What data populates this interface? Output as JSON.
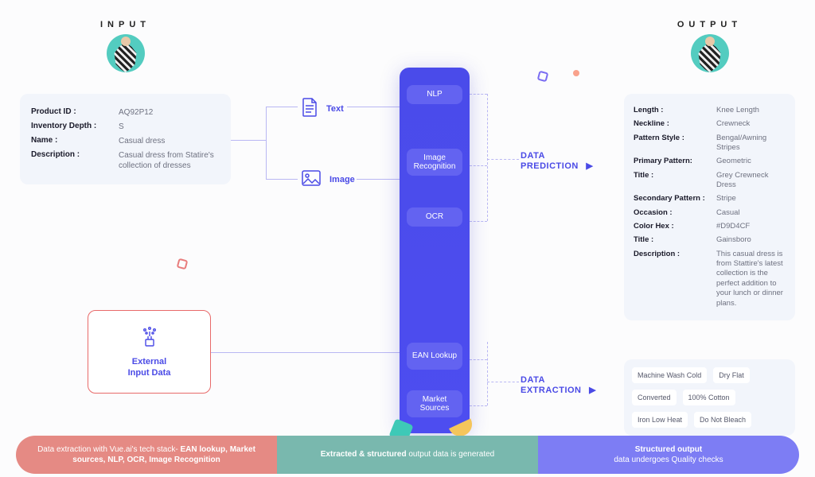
{
  "headers": {
    "input": "INPUT",
    "output": "OUTPUT"
  },
  "input_card": {
    "product_id_k": "Product ID :",
    "product_id_v": "AQ92P12",
    "inv_k": "Inventory Depth :",
    "inv_v": "S",
    "name_k": "Name :",
    "name_v": "Casual dress",
    "desc_k": "Description :",
    "desc_v": "Casual dress from Statire's collection of dresses"
  },
  "mid": {
    "text": "Text",
    "image": "Image"
  },
  "center_pills": {
    "nlp": "NLP",
    "imgrec": "Image Recognition",
    "ocr": "OCR",
    "ean": "EAN Lookup",
    "market": "Market Sources"
  },
  "external": {
    "label": "External\nInput Data"
  },
  "flow": {
    "prediction": "DATA\nPREDICTION",
    "extraction": "DATA\nEXTRACTION"
  },
  "output_card": {
    "rows": [
      [
        "Length :",
        "Knee Length"
      ],
      [
        "Neckline :",
        "Crewneck"
      ],
      [
        "Pattern Style :",
        "Bengal/Awning Stripes"
      ],
      [
        "Primary Pattern:",
        "Geometric"
      ],
      [
        "Title :",
        "Grey Crewneck Dress"
      ],
      [
        "Secondary Pattern :",
        "Stripe"
      ],
      [
        "Occasion :",
        "Casual"
      ],
      [
        "Color Hex :",
        "#D9D4CF"
      ],
      [
        "Title :",
        "Gainsboro"
      ],
      [
        "Description :",
        "This casual dress is from Stattire's latest collection is the perfect addition to your lunch or dinner plans."
      ]
    ]
  },
  "tags": [
    "Machine Wash Cold",
    "Dry Flat",
    "Converted",
    "100% Cotton",
    "Iron Low Heat",
    "Do Not Bleach"
  ],
  "banner": {
    "left": "Data extraction with Vue.ai's tech stack- EAN lookup, Market sources, NLP, OCR, Image Recognition",
    "left_bold": "EAN lookup, Market sources, NLP, OCR, Image Recognition",
    "mid_line1": "Extracted &",
    "mid_line2": "structured",
    "mid_rest": " output data is generated",
    "right_line1": "Structured output",
    "right_rest": "data undergoes Quality checks"
  }
}
